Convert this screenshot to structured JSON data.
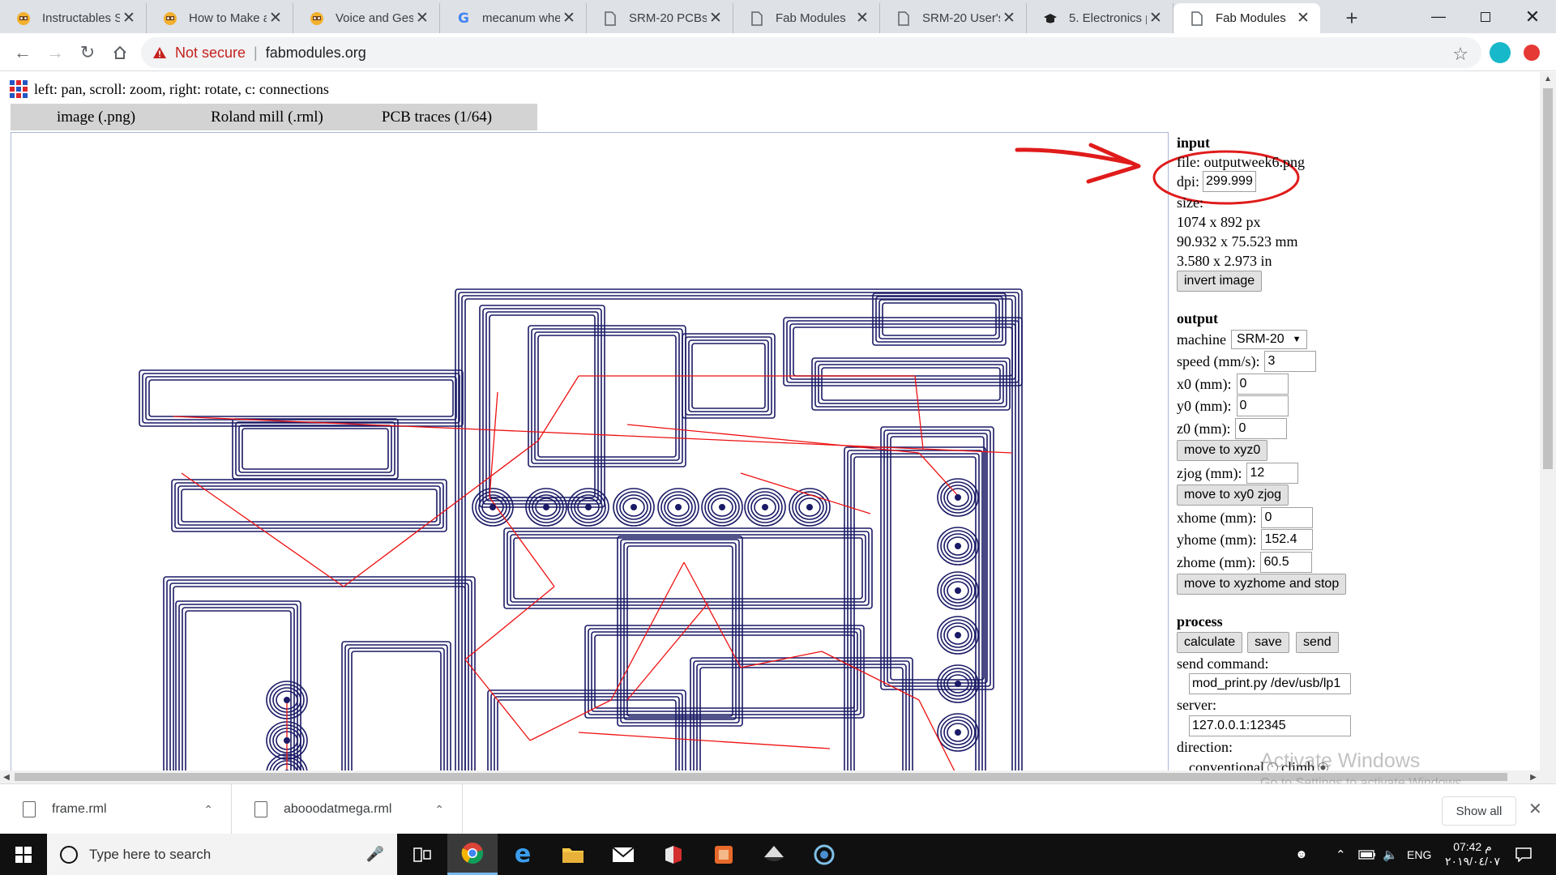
{
  "browser": {
    "tabs": [
      {
        "title": "Instructables Se",
        "favicon": "instructables-robot-icon",
        "active": false
      },
      {
        "title": "How to Make a",
        "favicon": "instructables-robot-icon",
        "active": false
      },
      {
        "title": "Voice and Gest",
        "favicon": "instructables-robot-icon",
        "active": false
      },
      {
        "title": "mecanum whe",
        "favicon": "google-g-icon",
        "active": false
      },
      {
        "title": "SRM-20 PCBs",
        "favicon": "document-icon",
        "active": false
      },
      {
        "title": "Fab Modules",
        "favicon": "document-icon",
        "active": false
      },
      {
        "title": "SRM-20 User's",
        "favicon": "document-icon",
        "active": false
      },
      {
        "title": "5. Electronics p",
        "favicon": "graduation-cap-icon",
        "active": false
      },
      {
        "title": "Fab Modules",
        "favicon": "document-icon",
        "active": true
      }
    ],
    "security_label": "Not secure",
    "url": "fabmodules.org"
  },
  "page": {
    "hint": "left: pan, scroll: zoom, right: rotate, c: connections",
    "formats": [
      "image (.png)",
      "Roland mill (.rml)",
      "PCB traces (1/64)"
    ],
    "input": {
      "heading": "input",
      "file_label": "file:",
      "file_name": "outputweek6.png",
      "dpi_label": "dpi:",
      "dpi_value": "299.999",
      "size_label": "size:",
      "size_px": "1074 x 892 px",
      "size_mm": "90.932 x 75.523 mm",
      "size_in": "3.580 x 2.973 in",
      "invert_button": "invert image"
    },
    "output": {
      "heading": "output",
      "machine_label": "machine",
      "machine_value": "SRM-20",
      "speed_label": "speed (mm/s):",
      "speed_value": "3",
      "x0_label": "x0 (mm):",
      "x0_value": "0",
      "y0_label": "y0 (mm):",
      "y0_value": "0",
      "z0_label": "z0 (mm):",
      "z0_value": "0",
      "move_xyz0_button": "move to xyz0",
      "zjog_label": "zjog (mm):",
      "zjog_value": "12",
      "move_xy0_button": "move to xy0 zjog",
      "xhome_label": "xhome (mm):",
      "xhome_value": "0",
      "yhome_label": "yhome (mm):",
      "yhome_value": "152.4",
      "zhome_label": "zhome (mm):",
      "zhome_value": "60.5",
      "move_home_button": "move to xyzhome and stop"
    },
    "process": {
      "heading": "process",
      "calculate_button": "calculate",
      "save_button": "save",
      "send_button": "send",
      "send_command_label": "send command:",
      "send_command_value": "mod_print.py /dev/usb/lp1",
      "server_label": "server:",
      "server_value": "127.0.0.1:12345",
      "direction_label": "direction:",
      "direction_options": [
        "conventional",
        "climb"
      ]
    }
  },
  "downloads": {
    "items": [
      "frame.rml",
      "abooodatmega.rml"
    ],
    "show_all": "Show all"
  },
  "watermark": {
    "line1": "Activate Windows",
    "line2": "Go to Settings to activate Windows."
  },
  "taskbar": {
    "search_placeholder": "Type here to search",
    "language": "ENG",
    "time": "07:42 م",
    "date": "٢٠١٩/٠٤/٠٧"
  },
  "colors": {
    "trace": "#1a1a66",
    "connection": "#ee1111",
    "annotation": "#e01b1b",
    "tabstrip": "#dee1e6"
  }
}
